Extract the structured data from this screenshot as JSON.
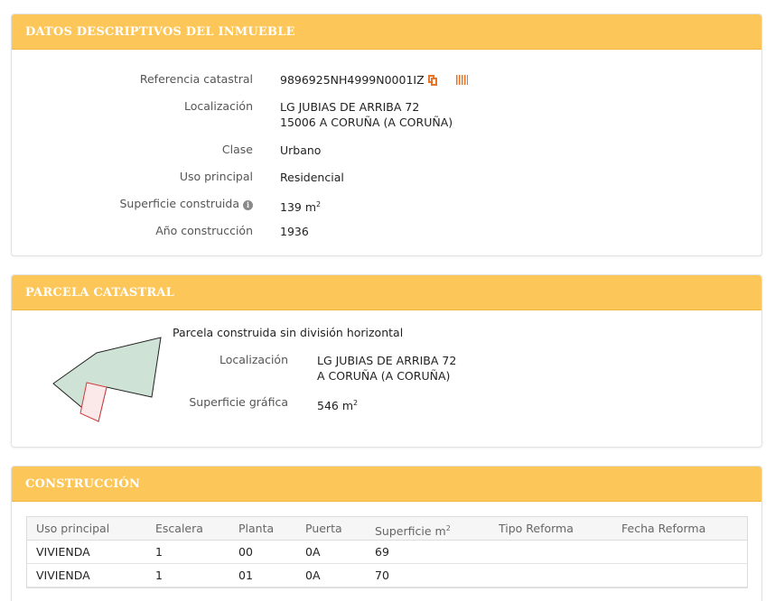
{
  "datos": {
    "title": "DATOS DESCRIPTIVOS DEL INMUEBLE",
    "ref_label": "Referencia catastral",
    "ref_value": "9896925NH4999N0001IZ",
    "loc_label": "Localización",
    "loc_line1": "LG JUBIAS DE ARRIBA 72",
    "loc_line2": "15006 A CORUÑA (A CORUÑA)",
    "clase_label": "Clase",
    "clase_value": "Urbano",
    "uso_label": "Uso principal",
    "uso_value": "Residencial",
    "sup_label": "Superficie construida",
    "sup_value": "139 m",
    "sup_exp": "2",
    "anio_label": "Año construcción",
    "anio_value": "1936"
  },
  "parcela": {
    "title": "PARCELA CATASTRAL",
    "subtitle": "Parcela construida sin división horizontal",
    "loc_label": "Localización",
    "loc_line1": "LG JUBIAS DE ARRIBA 72",
    "loc_line2": "A CORUÑA (A CORUÑA)",
    "sup_label": "Superficie gráfica",
    "sup_value": "546 m",
    "sup_exp": "2"
  },
  "construccion": {
    "title": "CONSTRUCCIÓN",
    "headers": [
      "Uso principal",
      "Escalera",
      "Planta",
      "Puerta",
      "Superficie m",
      "Tipo Reforma",
      "Fecha Reforma"
    ],
    "header_exp": "2",
    "rows": [
      [
        "VIVIENDA",
        "1",
        "00",
        "0A",
        "69",
        "",
        ""
      ],
      [
        "VIVIENDA",
        "1",
        "01",
        "0A",
        "70",
        "",
        ""
      ]
    ]
  },
  "colors": {
    "header_bg": "#fcc658",
    "accent_icon": "#e8742a",
    "parcel_fill": "#cfe2d6",
    "building_fill": "#fbe9ea",
    "building_stroke": "#d23c3c"
  },
  "icons": [
    "info-icon",
    "copy-icon",
    "barcode-icon"
  ]
}
